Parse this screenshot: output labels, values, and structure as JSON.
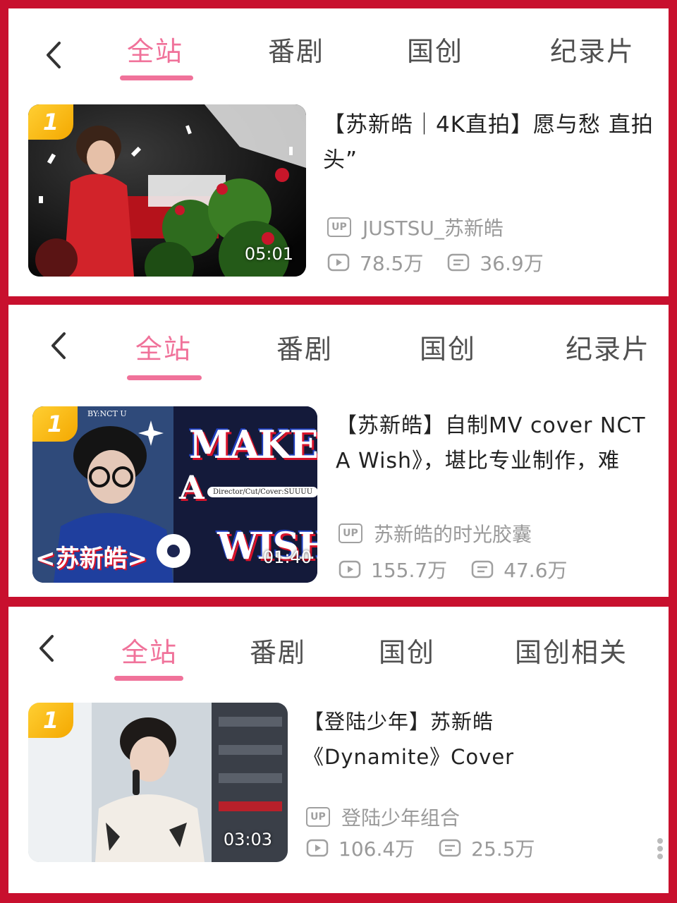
{
  "panels": [
    {
      "tabs": [
        "全站",
        "番剧",
        "国创",
        "纪录片"
      ],
      "video": {
        "rank": "1",
        "duration": "05:01",
        "title": "【苏新皓｜4K直拍】愿与愁 直拍头”",
        "uploader": "JUSTSU_苏新皓",
        "views": "78.5万",
        "comments": "36.9万"
      }
    },
    {
      "tabs": [
        "全站",
        "番剧",
        "国创",
        "纪录片"
      ],
      "video": {
        "rank": "1",
        "duration": "01:40",
        "title": "【苏新皓】自制MV cover NCT A Wish》，堪比专业制作，难",
        "uploader": "苏新皓的时光胶囊",
        "views": "155.7万",
        "comments": "47.6万",
        "thumb_text": {
          "credit": "BY:NCT U",
          "make": "MAKE",
          "a": "A",
          "wish": "WISH",
          "director": "Director/Cut/Cover:SUUUU",
          "name": "<苏新皓>"
        }
      }
    },
    {
      "tabs": [
        "全站",
        "番剧",
        "国创",
        "国创相关"
      ],
      "video": {
        "rank": "1",
        "duration": "03:03",
        "title": "【登陆少年】苏新皓《Dynamite》Cover",
        "uploader": "登陆少年组合",
        "views": "106.4万",
        "comments": "25.5万"
      }
    }
  ],
  "icons": {
    "back": "chevron-left-icon",
    "up": "UP",
    "views": "play-icon",
    "comments": "danmaku-icon"
  },
  "colors": {
    "accent": "#f0729a",
    "frame": "#c8102e",
    "rank_badge": "#f4a800"
  }
}
